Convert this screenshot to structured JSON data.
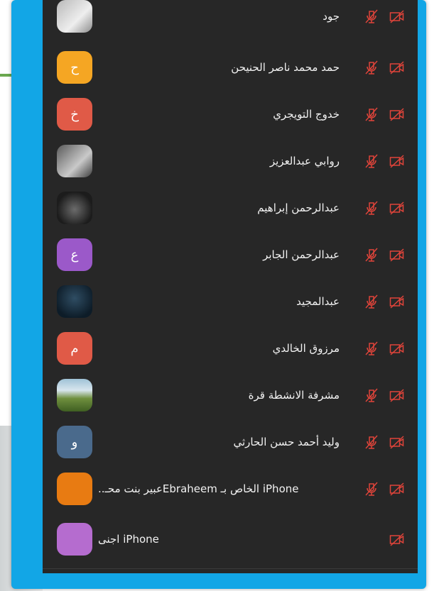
{
  "participants": [
    {
      "name": "جود",
      "avatar_letter": "",
      "avatar_color": "#b0b0b0",
      "mic": "muted",
      "camera": "off"
    },
    {
      "name": "حمد محمد ناصر الحنيحن",
      "avatar_letter": "ح",
      "avatar_color": "#f5a623",
      "mic": "muted",
      "camera": "off"
    },
    {
      "name": "خدوج التويجري",
      "avatar_letter": "خ",
      "avatar_color": "#e05a47",
      "mic": "muted",
      "camera": "off"
    },
    {
      "name": "روابي عبدالعزيز",
      "avatar_letter": "",
      "avatar_color": "#555555",
      "mic": "muted",
      "camera": "off"
    },
    {
      "name": "عبدالرحمن إبراهيم",
      "avatar_letter": "",
      "avatar_color": "#333333",
      "mic": "muted",
      "camera": "off"
    },
    {
      "name": "عبدالرحمن الجابر",
      "avatar_letter": "ع",
      "avatar_color": "#9b59c9",
      "mic": "muted",
      "camera": "off"
    },
    {
      "name": "عبدالمجيد",
      "avatar_letter": "",
      "avatar_color": "#1e3a52",
      "mic": "muted",
      "camera": "off"
    },
    {
      "name": "مرزوق الخالدي",
      "avatar_letter": "م",
      "avatar_color": "#e05a47",
      "mic": "muted",
      "camera": "off"
    },
    {
      "name": "مشرفة الانشطة قرة",
      "avatar_letter": "",
      "avatar_color": "#7c9a4a",
      "mic": "muted",
      "camera": "off"
    },
    {
      "name": "وليد أحمد حسن الحارثي",
      "avatar_letter": "و",
      "avatar_color": "#4a6a8c",
      "mic": "muted",
      "camera": "off"
    },
    {
      "name": "iPhone الخاص بـ Ebraheemعبير بنت محـ..",
      "avatar_letter": "",
      "avatar_color": "#e87b12",
      "mic": "muted",
      "camera": "off"
    },
    {
      "name": "iPhone اجنى",
      "avatar_letter": "",
      "avatar_color": "#b56ccf",
      "mic": "none",
      "camera": "off"
    }
  ],
  "colors": {
    "frame": "#12a6e6",
    "panel": "#272727",
    "text": "#f2f2f2",
    "muted_icon": "#e0443a"
  },
  "icons": {
    "mic": "mic-muted-icon",
    "camera": "video-off-icon"
  }
}
